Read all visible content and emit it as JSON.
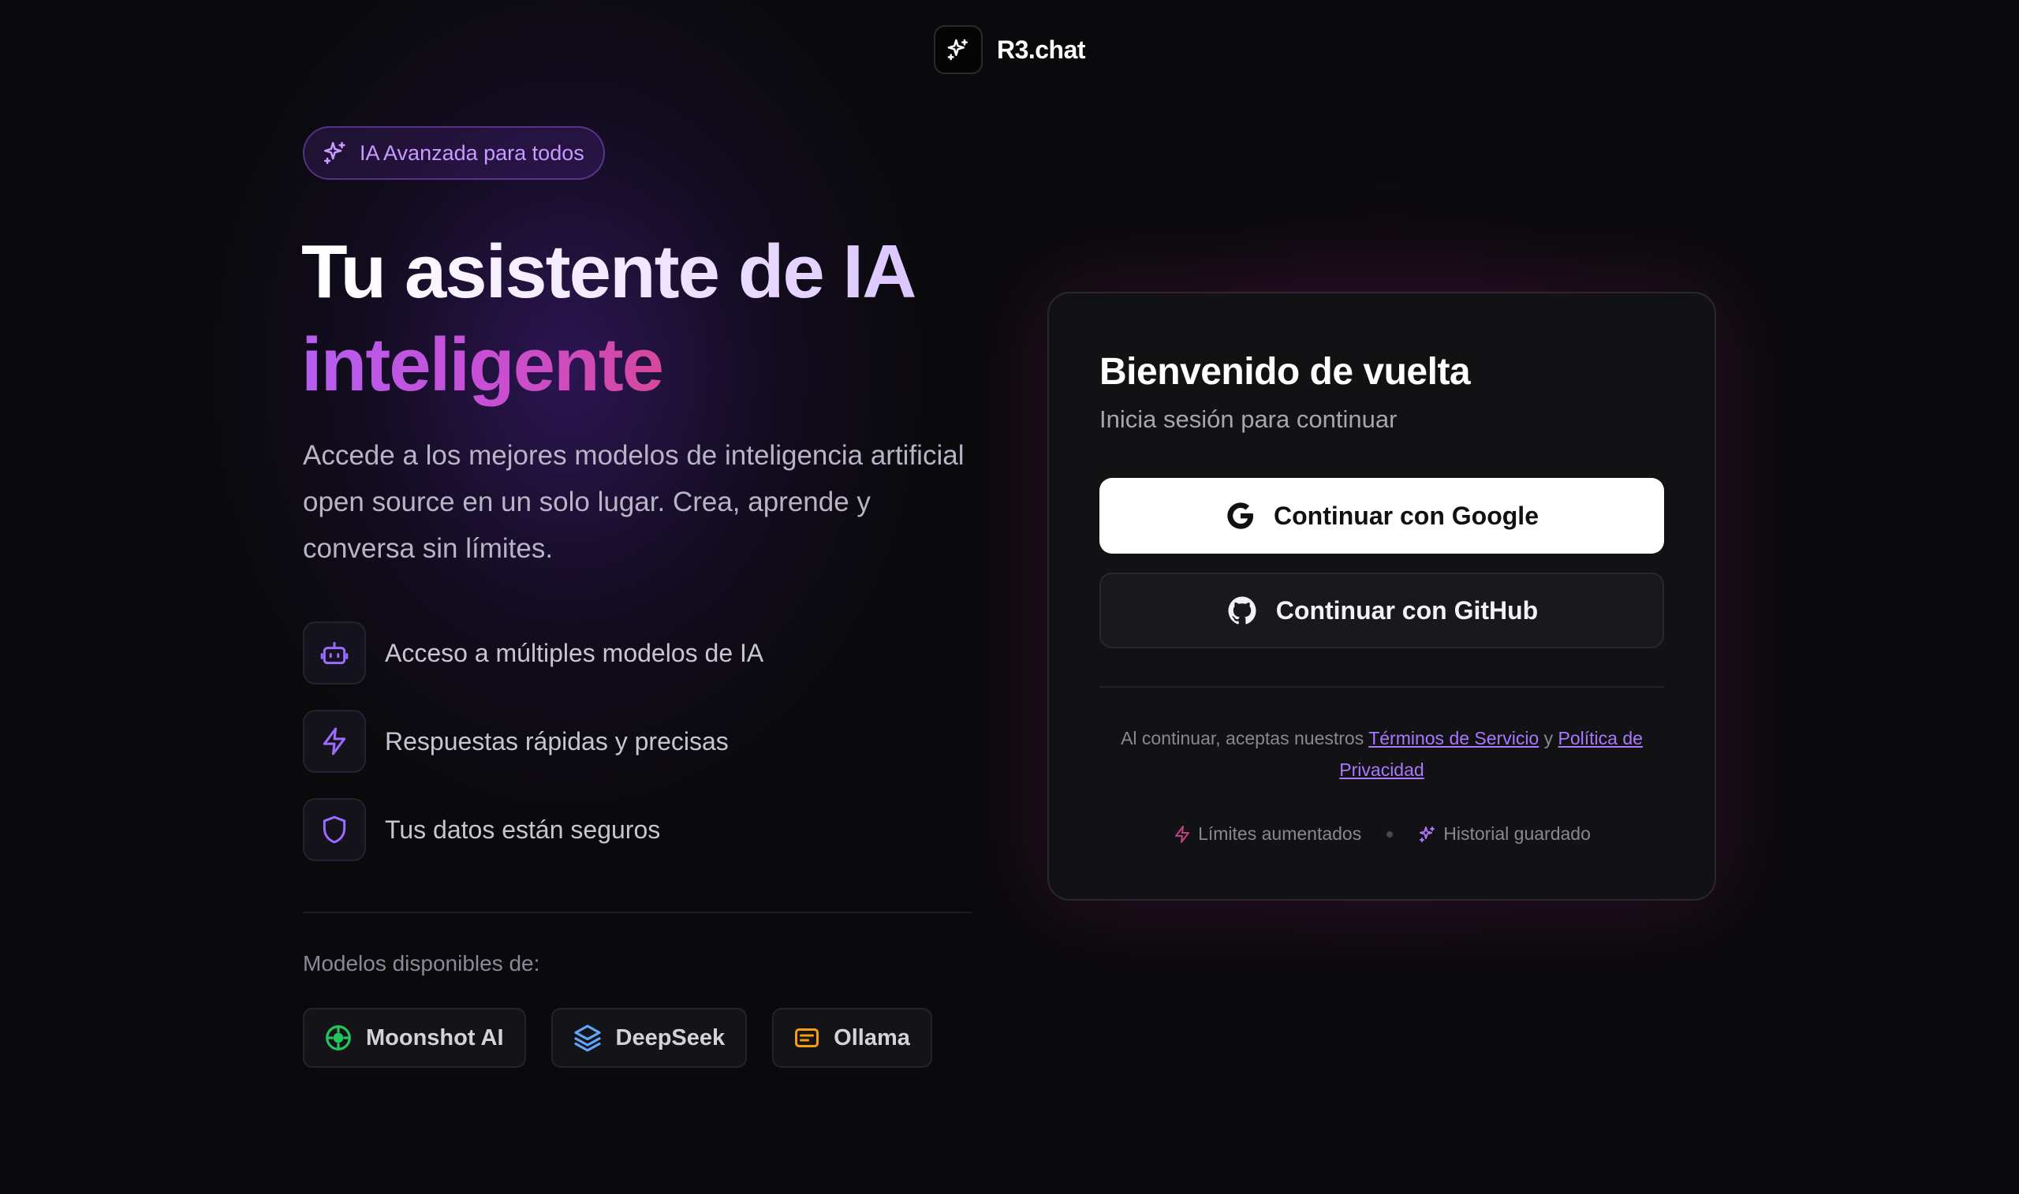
{
  "header": {
    "app_title": "R3.chat",
    "logo_icon": "sparkles-icon"
  },
  "hero": {
    "badge": "IA Avanzada para todos",
    "title_line1": "Tu asistente de IA",
    "title_line2": "inteligente",
    "description": "Accede a los mejores modelos de inteligencia artificial open source en un solo lugar. Crea, aprende y conversa sin límites."
  },
  "features": [
    {
      "icon": "bot-icon",
      "text": "Acceso a múltiples modelos de IA"
    },
    {
      "icon": "lightning-icon",
      "text": "Respuestas rápidas y precisas"
    },
    {
      "icon": "shield-icon",
      "text": "Tus datos están seguros"
    }
  ],
  "models": {
    "label": "Modelos disponibles de:",
    "items": [
      {
        "name": "Moonshot AI",
        "icon": "moonshot-icon",
        "color": "#22c55e"
      },
      {
        "name": "DeepSeek",
        "icon": "layers-icon",
        "color": "#60a5fa"
      },
      {
        "name": "Ollama",
        "icon": "message-square-icon",
        "color": "#f59e0b"
      }
    ]
  },
  "login": {
    "title": "Bienvenido de vuelta",
    "subtitle": "Inicia sesión para continuar",
    "google_label": "Continuar con Google",
    "github_label": "Continuar con GitHub",
    "terms_prefix": "Al continuar, aceptas nuestros",
    "terms_link": "Términos de Servicio",
    "terms_and": "y",
    "privacy_link": "Política de Privacidad",
    "perks": [
      "Límites aumentados",
      "Historial guardado"
    ]
  },
  "colors": {
    "accent_purple": "#a978ff",
    "accent_pink": "#d6479f",
    "background": "#0a0a0c"
  }
}
